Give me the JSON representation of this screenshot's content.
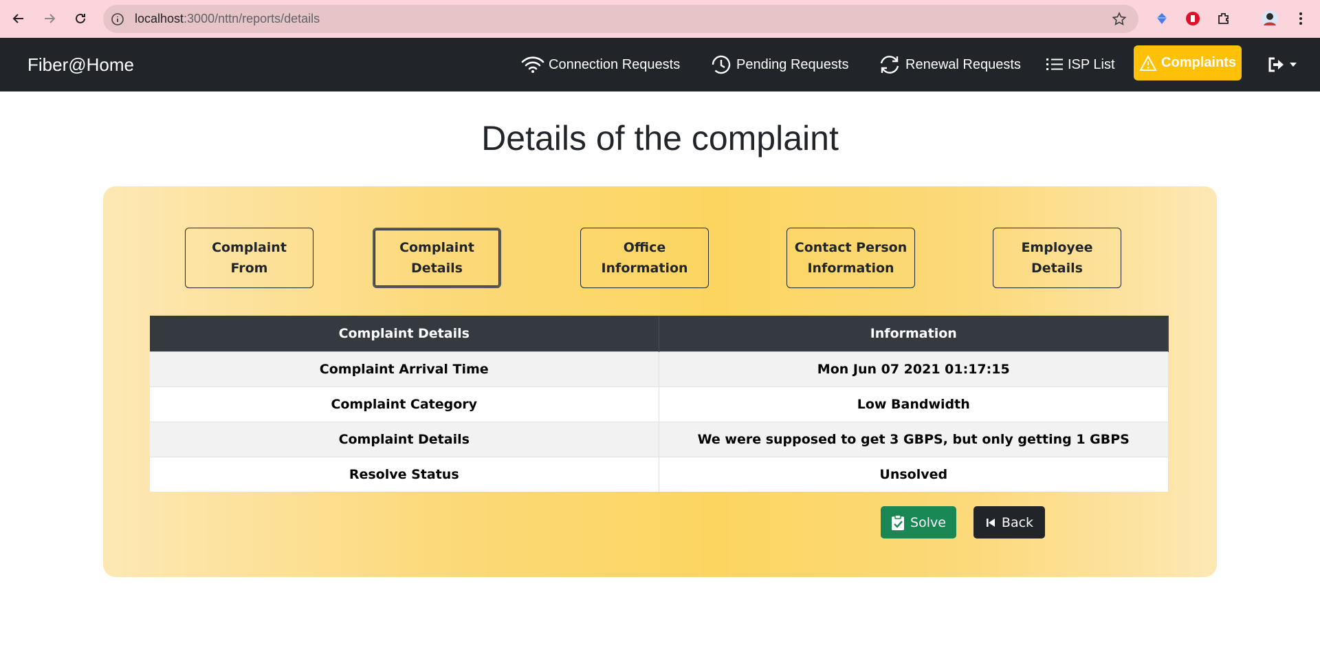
{
  "browser": {
    "url_host": "localhost",
    "url_path": ":3000/nttn/reports/details",
    "icons": [
      "back-arrow-icon",
      "forward-arrow-icon",
      "reload-icon",
      "site-info-icon",
      "bookmark-star-icon",
      "extension-icon",
      "profile-avatar",
      "menu-kebab-icon"
    ]
  },
  "navbar": {
    "brand": "Fiber@Home",
    "items": [
      {
        "label": "Connection Requests",
        "icon": "wifi-icon"
      },
      {
        "label": "Pending Requests",
        "icon": "clock-history-icon"
      },
      {
        "label": "Renewal Requests",
        "icon": "refresh-icon"
      },
      {
        "label": "ISP List",
        "icon": "list-icon"
      }
    ],
    "complaints_label": "Complaints",
    "complaints_icon": "warning-icon",
    "accent_color": "#ffc107",
    "bg_color": "#212529"
  },
  "page": {
    "title": "Details of the complaint"
  },
  "tabs": [
    {
      "label": "Complaint\nFrom",
      "active": false
    },
    {
      "label": "Complaint\nDetails",
      "active": true
    },
    {
      "label": "Office\nInformation",
      "active": false
    },
    {
      "label": "Contact Person\nInformation",
      "active": false
    },
    {
      "label": "Employee\nDetails",
      "active": false
    }
  ],
  "table": {
    "headers": [
      "Complaint Details",
      "Information"
    ],
    "rows": [
      {
        "label": "Complaint Arrival Time",
        "value": "Mon Jun 07 2021 01:17:15"
      },
      {
        "label": "Complaint Category",
        "value": "Low Bandwidth"
      },
      {
        "label": "Complaint Details",
        "value": "We were supposed to get 3 GBPS, but only getting 1 GBPS"
      },
      {
        "label": "Resolve Status",
        "value": "Unsolved"
      }
    ]
  },
  "actions": {
    "solve_label": "Solve",
    "back_label": "Back",
    "solve_color": "#198754",
    "back_color": "#212529"
  }
}
